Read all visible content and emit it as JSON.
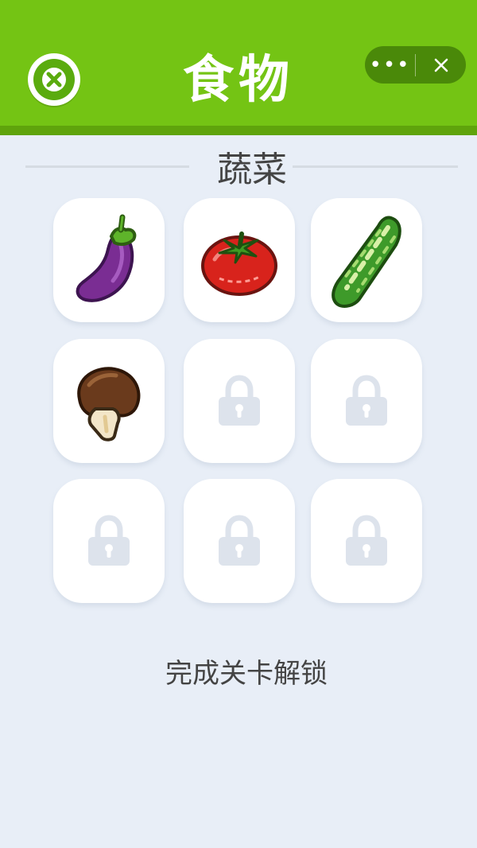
{
  "header": {
    "title": "食物",
    "close_icon": "close-circle-icon",
    "capsule": {
      "more_label": "•••",
      "close_icon": "close-icon"
    },
    "colors": {
      "bar": "#74c414",
      "bar_shadow": "#5fa40c"
    }
  },
  "section": {
    "title": "蔬菜"
  },
  "grid": [
    {
      "item": "eggplant-icon",
      "locked": false
    },
    {
      "item": "tomato-icon",
      "locked": false
    },
    {
      "item": "cucumber-icon",
      "locked": false
    },
    {
      "item": "mushroom-icon",
      "locked": false
    },
    {
      "item": "lock-icon",
      "locked": true
    },
    {
      "item": "lock-icon",
      "locked": true
    },
    {
      "item": "lock-icon",
      "locked": true
    },
    {
      "item": "lock-icon",
      "locked": true
    },
    {
      "item": "lock-icon",
      "locked": true
    }
  ],
  "footer": {
    "text": "完成关卡解锁"
  }
}
